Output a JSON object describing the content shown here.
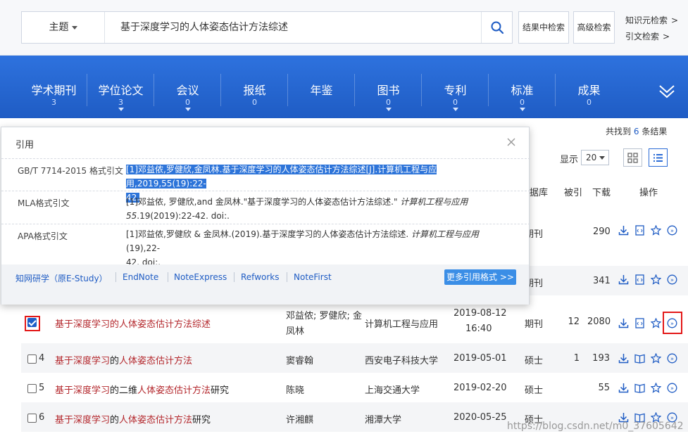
{
  "search": {
    "scope": "主题",
    "query": "基于深度学习的人体姿态估计方法综述",
    "btn_within": "结果中检索",
    "btn_advanced": "高级检索",
    "link_knowledge": "知识元检索",
    "link_citation": "引文检索",
    "arrow": ">"
  },
  "db_tabs": [
    {
      "name": "学术期刊",
      "count": "3"
    },
    {
      "name": "学位论文",
      "count": "3"
    },
    {
      "name": "会议",
      "count": "0"
    },
    {
      "name": "报纸",
      "count": "0"
    },
    {
      "name": "年鉴",
      "count": ""
    },
    {
      "name": "图书",
      "count": "0"
    },
    {
      "name": "专利",
      "count": "0"
    },
    {
      "name": "标准",
      "count": "0"
    },
    {
      "name": "成果",
      "count": "0"
    }
  ],
  "results": {
    "found_prefix": "共找到",
    "found_count": "6",
    "found_suffix": "条结果",
    "show_label": "显示",
    "page_size": "20",
    "headers": {
      "db": "据库",
      "cited": "被引",
      "download": "下载",
      "ops": "操作"
    }
  },
  "rows": [
    {
      "num": "",
      "title_parts": [],
      "author": "",
      "source": "",
      "date": "",
      "time": "",
      "db": "期刊",
      "cited": "",
      "download": "290",
      "checked": false
    },
    {
      "num": "",
      "title_parts": [],
      "author": "",
      "source": "",
      "date": "",
      "time": "",
      "db": "期刊",
      "cited": "",
      "download": "341",
      "checked": false
    },
    {
      "num": "",
      "title_parts": [
        {
          "t": "基于深度学习的人体姿态估计方法综述",
          "hl": true
        }
      ],
      "author": "邓益侬; 罗健欣; 金",
      "author2": "凤林",
      "source": "计算机工程与应用",
      "date": "2019-08-12",
      "time": "16:40",
      "db": "期刊",
      "cited": "12",
      "download": "2080",
      "checked": true
    },
    {
      "num": "4",
      "title_parts": [
        {
          "t": "基于深度学习",
          "hl": true
        },
        {
          "t": "的",
          "hl": false
        },
        {
          "t": "人体姿态估计方法",
          "hl": true
        }
      ],
      "author": "窦睿翰",
      "source": "西安电子科技大学",
      "date": "2019-05-01",
      "db": "硕士",
      "cited": "1",
      "download": "193",
      "checked": false
    },
    {
      "num": "5",
      "title_parts": [
        {
          "t": "基于深度学习",
          "hl": true
        },
        {
          "t": "的二维",
          "hl": false
        },
        {
          "t": "人体姿态估计方法",
          "hl": true
        },
        {
          "t": "研究",
          "hl": false
        }
      ],
      "author": "陈晓",
      "source": "上海交通大学",
      "date": "2019-02-20",
      "db": "硕士",
      "cited": "",
      "download": "55",
      "checked": false
    },
    {
      "num": "6",
      "title_parts": [
        {
          "t": "基于深度学习",
          "hl": true
        },
        {
          "t": "的",
          "hl": false
        },
        {
          "t": "人体姿态估计方法",
          "hl": true
        },
        {
          "t": "研究",
          "hl": false
        }
      ],
      "author": "许湘麒",
      "source": "湘潭大学",
      "date": "2020-05-25",
      "db": "硕士",
      "cited": "",
      "download": "",
      "checked": false
    }
  ],
  "modal": {
    "title": "引用",
    "gbt_label": "GB/T 7714-2015 格式引文",
    "gbt_text_1": "[1]邓益侬,罗健欣,金凤林.基于深度学习的人体姿态估计方法综述[J].计算机工程与应用,2019,55(19):22-",
    "gbt_text_2": "42.",
    "mla_label": "MLA格式引文",
    "mla_text_a": "[1]邓益侬, 罗健欣,and 金凤林.\"基于深度学习的人体姿态估计方法综述.\" ",
    "mla_journal": "计算机工程与应用",
    "mla_vol": "55",
    "mla_text_b": ".19(2019):22-42. doi:.",
    "apa_label": "APA格式引文",
    "apa_text_a": "[1]邓益侬,罗健欣 & 金凤林.(2019).基于深度学习的人体姿态估计方法综述. ",
    "apa_journal": "计算机工程与应用",
    "apa_text_b": "(19),22-",
    "apa_text_c": "42. doi:.",
    "links": [
      "知网研学（原E-Study）",
      "EndNote",
      "NoteExpress",
      "Refworks",
      "NoteFirst"
    ],
    "more_btn": "更多引用格式 >>"
  },
  "watermark": "https://blog.csdn.net/m0_37605642",
  "colors": {
    "brand_blue": "#2a6bd6",
    "title_red": "#b3262b",
    "highlight": "#2d74d9",
    "annotation_red": "#e31818"
  }
}
